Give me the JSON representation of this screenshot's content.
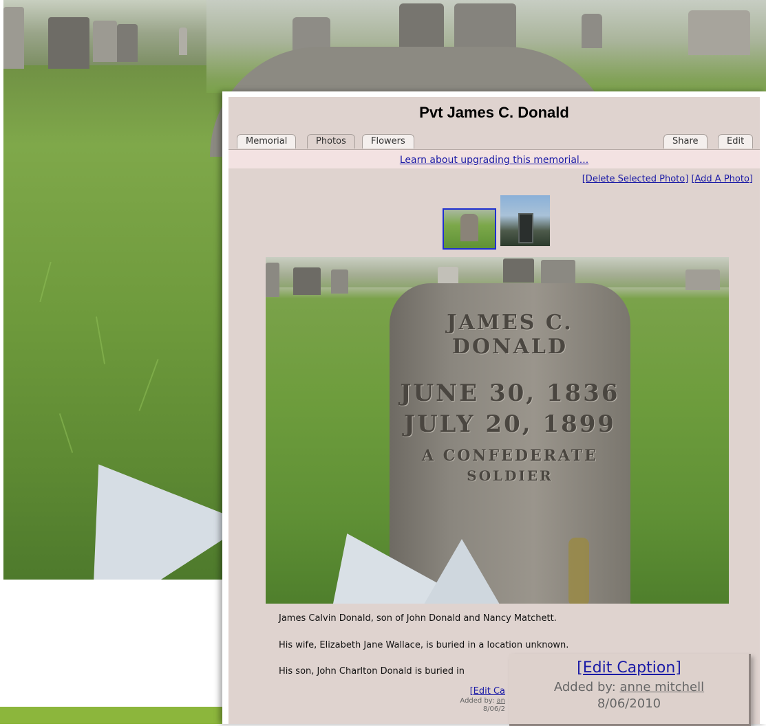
{
  "memorial": {
    "title": "Pvt James C. Donald"
  },
  "tabs": {
    "left": [
      "Memorial",
      "Photos",
      "Flowers"
    ],
    "right": [
      "Share",
      "Edit"
    ],
    "active": "Photos"
  },
  "upgrade": {
    "link_text": "Learn about upgrading this memorial..."
  },
  "photo_actions": {
    "delete": "[Delete Selected Photo]",
    "add": "[Add A Photo]"
  },
  "headstone": {
    "name": "JAMES C. DONALD",
    "born": "JUNE 30, 1836",
    "died": "JULY 20, 1899",
    "line3": "A CONFEDERATE",
    "line4": "SOLDIER"
  },
  "caption": {
    "line1": "James Calvin Donald, son of John Donald and Nancy Matchett.",
    "line2": "His wife, Elizabeth Jane Wallace, is buried in a location unknown.",
    "line3": "His son, John Charlton Donald is buried in",
    "edit_small": "[Edit Ca",
    "added_small_label": "Added by: ",
    "added_small_user": "an",
    "added_small_date": "8/06/2"
  },
  "zoom": {
    "edit_caption": "[Edit Caption]",
    "added_by_label": "Added by: ",
    "added_by_user": "anne mitchell",
    "date": "8/06/2010"
  },
  "colors": {
    "panel_bg": "#dfd3cf",
    "upgrade_bg": "#f3e2e2",
    "link": "#1a1aa6",
    "thumb_selected_border": "#1e2fd0",
    "accent_bar": "#8cb63c"
  }
}
